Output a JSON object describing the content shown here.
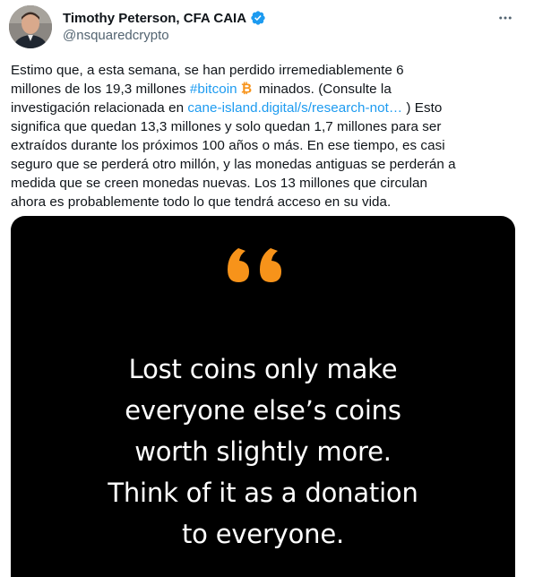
{
  "author": {
    "display_name": "Timothy Peterson, CFA CAIA",
    "handle": "@nsquaredcrypto",
    "verified": true
  },
  "tweet": {
    "line1": "Estimo que, a esta semana, se han perdido irremediablemente 6",
    "line2_pre": "millones de los 19,3 millones ",
    "hashtag": "#bitcoin",
    "line2_post": " minados. (Consulte la",
    "line3_pre": "investigación relacionada en ",
    "link": "cane-island.digital/s/research-not…",
    "line3_post": " ) Esto",
    "line4": "significa que quedan 13,3 millones y solo quedan 1,7 millones para ser",
    "line5": "extraídos durante los próximos 100 años o más. En ese tiempo, es casi",
    "line6": "seguro que se perderá otro millón, y las monedas antiguas se perderán a",
    "line7": "medida que se creen monedas nuevas. Los 13 millones que circulan",
    "line8": "ahora es probablemente todo lo que tendrá acceso en su vida."
  },
  "media": {
    "quote_lines": [
      "Lost coins only make",
      "everyone else’s coins",
      "worth slightly more.",
      "Think of it as a donation",
      "to everyone."
    ]
  },
  "colors": {
    "link": "#1d9bf0",
    "verified_badge": "#1d9bf0",
    "bitcoin": "#f7931a",
    "quote_mark": "#f7931a",
    "media_bg": "#000000"
  },
  "icons": {
    "verified": "verified-badge-icon",
    "more": "more-options-icon",
    "bitcoin": "bitcoin-emoji-icon",
    "quote": "quotation-mark-icon"
  }
}
